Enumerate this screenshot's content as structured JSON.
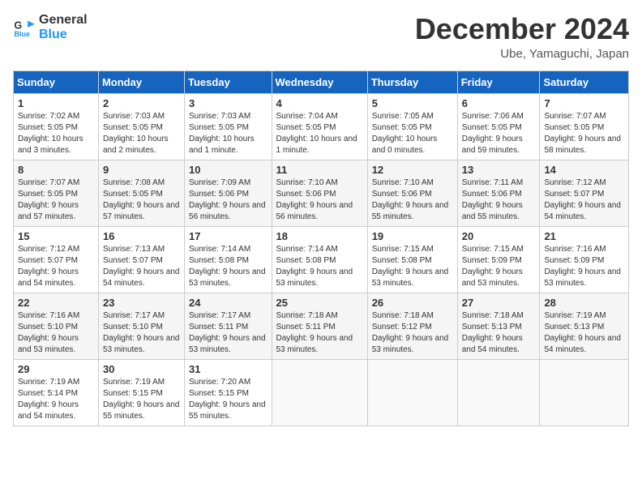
{
  "logo": {
    "line1": "General",
    "line2": "Blue"
  },
  "title": "December 2024",
  "location": "Ube, Yamaguchi, Japan",
  "weekdays": [
    "Sunday",
    "Monday",
    "Tuesday",
    "Wednesday",
    "Thursday",
    "Friday",
    "Saturday"
  ],
  "weeks": [
    [
      {
        "day": "1",
        "sunrise": "7:02 AM",
        "sunset": "5:05 PM",
        "daylight": "10 hours and 3 minutes."
      },
      {
        "day": "2",
        "sunrise": "7:03 AM",
        "sunset": "5:05 PM",
        "daylight": "10 hours and 2 minutes."
      },
      {
        "day": "3",
        "sunrise": "7:03 AM",
        "sunset": "5:05 PM",
        "daylight": "10 hours and 1 minute."
      },
      {
        "day": "4",
        "sunrise": "7:04 AM",
        "sunset": "5:05 PM",
        "daylight": "10 hours and 1 minute."
      },
      {
        "day": "5",
        "sunrise": "7:05 AM",
        "sunset": "5:05 PM",
        "daylight": "10 hours and 0 minutes."
      },
      {
        "day": "6",
        "sunrise": "7:06 AM",
        "sunset": "5:05 PM",
        "daylight": "9 hours and 59 minutes."
      },
      {
        "day": "7",
        "sunrise": "7:07 AM",
        "sunset": "5:05 PM",
        "daylight": "9 hours and 58 minutes."
      }
    ],
    [
      {
        "day": "8",
        "sunrise": "7:07 AM",
        "sunset": "5:05 PM",
        "daylight": "9 hours and 57 minutes."
      },
      {
        "day": "9",
        "sunrise": "7:08 AM",
        "sunset": "5:05 PM",
        "daylight": "9 hours and 57 minutes."
      },
      {
        "day": "10",
        "sunrise": "7:09 AM",
        "sunset": "5:06 PM",
        "daylight": "9 hours and 56 minutes."
      },
      {
        "day": "11",
        "sunrise": "7:10 AM",
        "sunset": "5:06 PM",
        "daylight": "9 hours and 56 minutes."
      },
      {
        "day": "12",
        "sunrise": "7:10 AM",
        "sunset": "5:06 PM",
        "daylight": "9 hours and 55 minutes."
      },
      {
        "day": "13",
        "sunrise": "7:11 AM",
        "sunset": "5:06 PM",
        "daylight": "9 hours and 55 minutes."
      },
      {
        "day": "14",
        "sunrise": "7:12 AM",
        "sunset": "5:07 PM",
        "daylight": "9 hours and 54 minutes."
      }
    ],
    [
      {
        "day": "15",
        "sunrise": "7:12 AM",
        "sunset": "5:07 PM",
        "daylight": "9 hours and 54 minutes."
      },
      {
        "day": "16",
        "sunrise": "7:13 AM",
        "sunset": "5:07 PM",
        "daylight": "9 hours and 54 minutes."
      },
      {
        "day": "17",
        "sunrise": "7:14 AM",
        "sunset": "5:08 PM",
        "daylight": "9 hours and 53 minutes."
      },
      {
        "day": "18",
        "sunrise": "7:14 AM",
        "sunset": "5:08 PM",
        "daylight": "9 hours and 53 minutes."
      },
      {
        "day": "19",
        "sunrise": "7:15 AM",
        "sunset": "5:08 PM",
        "daylight": "9 hours and 53 minutes."
      },
      {
        "day": "20",
        "sunrise": "7:15 AM",
        "sunset": "5:09 PM",
        "daylight": "9 hours and 53 minutes."
      },
      {
        "day": "21",
        "sunrise": "7:16 AM",
        "sunset": "5:09 PM",
        "daylight": "9 hours and 53 minutes."
      }
    ],
    [
      {
        "day": "22",
        "sunrise": "7:16 AM",
        "sunset": "5:10 PM",
        "daylight": "9 hours and 53 minutes."
      },
      {
        "day": "23",
        "sunrise": "7:17 AM",
        "sunset": "5:10 PM",
        "daylight": "9 hours and 53 minutes."
      },
      {
        "day": "24",
        "sunrise": "7:17 AM",
        "sunset": "5:11 PM",
        "daylight": "9 hours and 53 minutes."
      },
      {
        "day": "25",
        "sunrise": "7:18 AM",
        "sunset": "5:11 PM",
        "daylight": "9 hours and 53 minutes."
      },
      {
        "day": "26",
        "sunrise": "7:18 AM",
        "sunset": "5:12 PM",
        "daylight": "9 hours and 53 minutes."
      },
      {
        "day": "27",
        "sunrise": "7:18 AM",
        "sunset": "5:13 PM",
        "daylight": "9 hours and 54 minutes."
      },
      {
        "day": "28",
        "sunrise": "7:19 AM",
        "sunset": "5:13 PM",
        "daylight": "9 hours and 54 minutes."
      }
    ],
    [
      {
        "day": "29",
        "sunrise": "7:19 AM",
        "sunset": "5:14 PM",
        "daylight": "9 hours and 54 minutes."
      },
      {
        "day": "30",
        "sunrise": "7:19 AM",
        "sunset": "5:15 PM",
        "daylight": "9 hours and 55 minutes."
      },
      {
        "day": "31",
        "sunrise": "7:20 AM",
        "sunset": "5:15 PM",
        "daylight": "9 hours and 55 minutes."
      },
      null,
      null,
      null,
      null
    ]
  ]
}
